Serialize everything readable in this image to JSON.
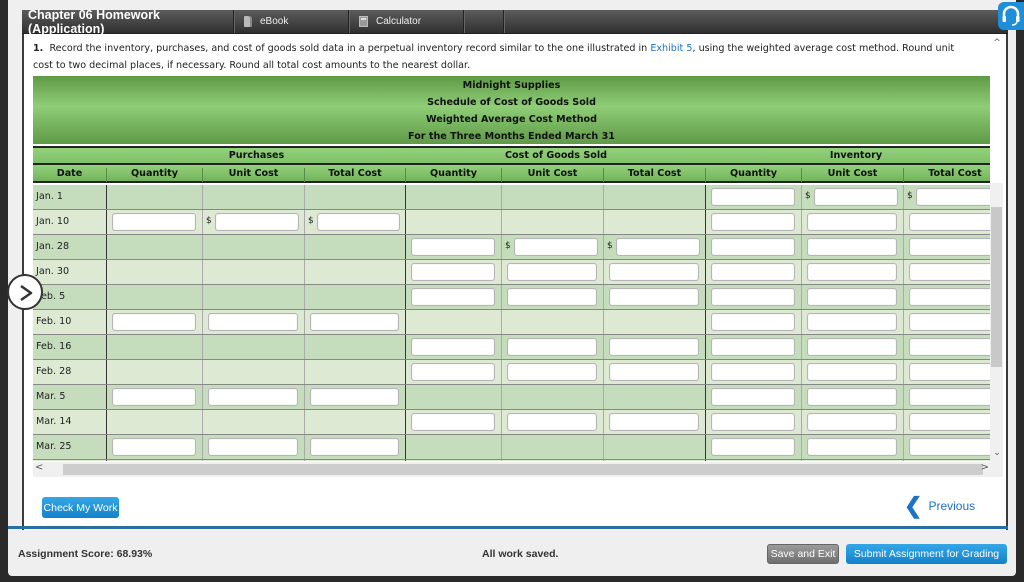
{
  "header": {
    "title": "Chapter 06 Homework (Application)",
    "tabs": [
      {
        "label": "eBook",
        "icon": "book-icon"
      },
      {
        "label": "Calculator",
        "icon": "calculator-icon"
      }
    ]
  },
  "question": {
    "number": "1.",
    "text_before_link": "Record the inventory, purchases, and cost of goods sold data in a perpetual inventory record similar to the one illustrated in ",
    "link": "Exhibit 5",
    "text_after_link": ", using the weighted average cost method. Round unit cost to two decimal places, if necessary. Round all total cost amounts to the nearest dollar."
  },
  "schedule": {
    "title_lines": [
      "Midnight Supplies",
      "Schedule of Cost of Goods Sold",
      "Weighted Average Cost Method",
      "For the Three Months Ended March 31"
    ],
    "groups": [
      "Purchases",
      "Cost of Goods Sold",
      "Inventory"
    ],
    "columns": [
      "Date",
      "Quantity",
      "Unit Cost",
      "Total Cost",
      "Quantity",
      "Unit Cost",
      "Total Cost",
      "Quantity",
      "Unit Cost",
      "Total Cost"
    ],
    "currency_symbol": "$",
    "rows": [
      {
        "date": "Jan. 1",
        "purchases": false,
        "cogs": false,
        "inventory": true,
        "dollar_inventory": true
      },
      {
        "date": "Jan. 10",
        "purchases": true,
        "cogs": false,
        "inventory": true,
        "dollar_purchases": true
      },
      {
        "date": "Jan. 28",
        "purchases": false,
        "cogs": true,
        "inventory": true,
        "dollar_cogs": true
      },
      {
        "date": "Jan. 30",
        "purchases": false,
        "cogs": true,
        "inventory": true
      },
      {
        "date": "Feb. 5",
        "purchases": false,
        "cogs": true,
        "inventory": true
      },
      {
        "date": "Feb. 10",
        "purchases": true,
        "cogs": false,
        "inventory": true
      },
      {
        "date": "Feb. 16",
        "purchases": false,
        "cogs": true,
        "inventory": true
      },
      {
        "date": "Feb. 28",
        "purchases": false,
        "cogs": true,
        "inventory": true
      },
      {
        "date": "Mar. 5",
        "purchases": true,
        "cogs": false,
        "inventory": true
      },
      {
        "date": "Mar. 14",
        "purchases": false,
        "cogs": true,
        "inventory": true
      },
      {
        "date": "Mar. 25",
        "purchases": true,
        "cogs": false,
        "inventory": true
      },
      {
        "date": "",
        "purchases": false,
        "cogs": true,
        "inventory": true
      }
    ]
  },
  "actions": {
    "check_my_work": "Check My Work",
    "previous": "Previous"
  },
  "footer": {
    "score": "Assignment Score: 68.93%",
    "status": "All work saved.",
    "save_exit": "Save and Exit",
    "submit": "Submit Assignment for Grading"
  },
  "colors": {
    "accent_blue": "#1a8ad4",
    "header_green": "#7fbf67",
    "row_dark": "#c5ddbd",
    "row_light": "#dde9d3"
  }
}
